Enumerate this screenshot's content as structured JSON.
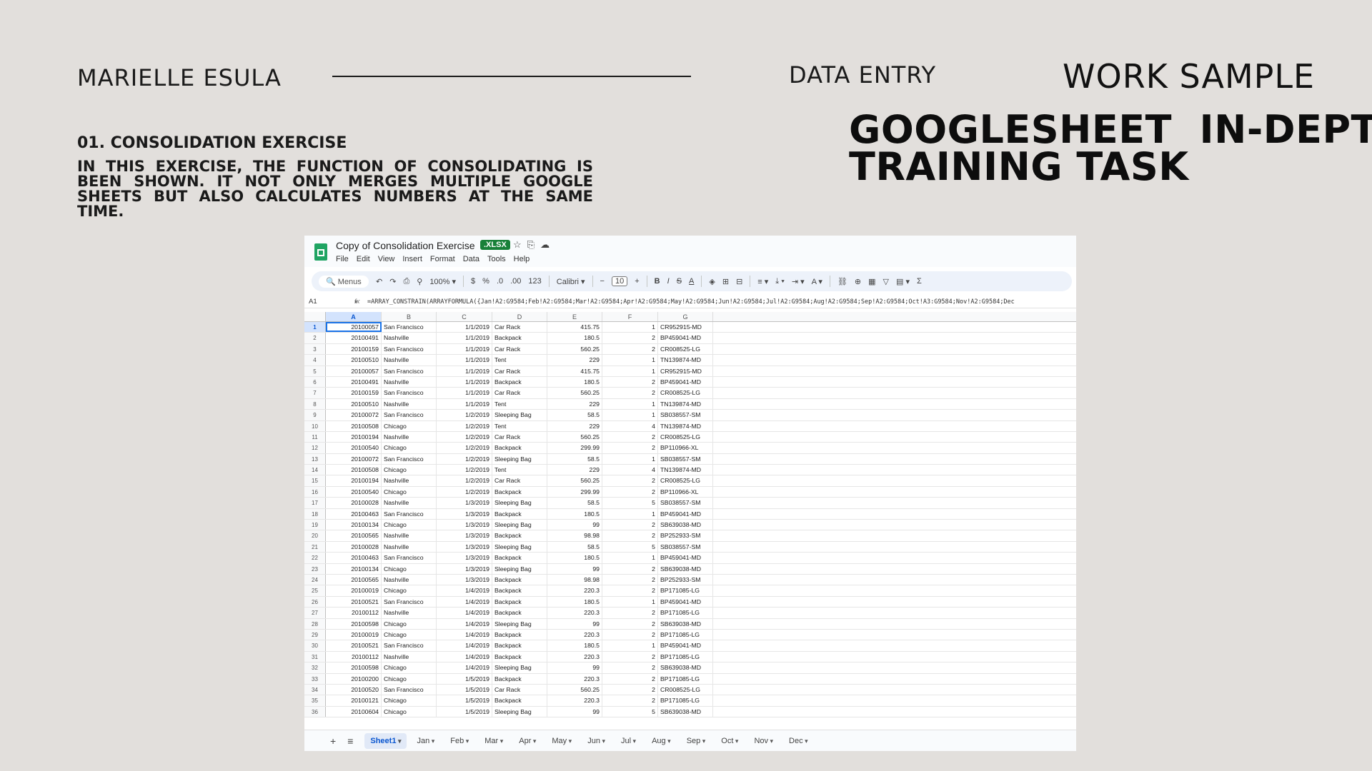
{
  "header": {
    "author": "MARIELLE ESULA",
    "category": "DATA ENTRY",
    "sample": "WORK SAMPLE",
    "headline_line1": "GOOGLESHEET  IN-DEPTH",
    "headline_line2": "TRAINING TASK"
  },
  "exercise": {
    "title": "01. CONSOLIDATION EXERCISE",
    "description": "IN THIS EXERCISE, THE FUNCTION OF CONSOLIDATING IS BEEN SHOWN. IT NOT ONLY MERGES MULTIPLE GOOGLE SHEETS BUT ALSO CALCULATES NUMBERS AT THE SAME TIME."
  },
  "sheet": {
    "doc_title": "Copy of Consolidation Exercise",
    "badge": ".XLSX",
    "title_icons": [
      "☆",
      "⎘",
      "☁"
    ],
    "menus": [
      "File",
      "Edit",
      "View",
      "Insert",
      "Format",
      "Data",
      "Tools",
      "Help"
    ],
    "toolbar": {
      "search": "Menus",
      "undo": "↶",
      "redo": "↷",
      "print": "⎙",
      "paint": "⚲",
      "zoom": "100% ▾",
      "currency": "$",
      "percent": "%",
      "dec_dec": ".0",
      "dec_inc": ".00",
      "numfmt": "123",
      "font": "Calibri ▾",
      "minus": "−",
      "size": "10",
      "plus": "+",
      "bold": "B",
      "italic": "I",
      "strike": "S",
      "textcolor": "A",
      "fill": "◈",
      "borders": "⊞",
      "merge": "⊟",
      "halign": "≡ ▾",
      "valign": "⤓ ▾",
      "wrap": "⇥ ▾",
      "rotate": "A ▾",
      "link": "⛓",
      "comment": "⊕",
      "chart": "▦",
      "filter": "▽",
      "views": "▤ ▾",
      "functions": "Σ"
    },
    "name_box": "A1",
    "name_box_arrow": "▾",
    "fx": "fx",
    "formula": "=ARRAY_CONSTRAIN(ARRAYFORMULA({Jan!A2:G9584;Feb!A2:G9584;Mar!A2:G9584;Apr!A2:G9584;May!A2:G9584;Jun!A2:G9584;Jul!A2:G9584;Aug!A2:G9584;Sep!A2:G9584;Oct!A3:G9584;Nov!A2:G9584;Dec",
    "columns": [
      "A",
      "B",
      "C",
      "D",
      "E",
      "F",
      "G"
    ],
    "rows": [
      [
        "1",
        "20100057",
        "San Francisco",
        "1/1/2019",
        "Car Rack",
        "415.75",
        "1",
        "CR952915-MD"
      ],
      [
        "2",
        "20100491",
        "Nashville",
        "1/1/2019",
        "Backpack",
        "180.5",
        "2",
        "BP459041-MD"
      ],
      [
        "3",
        "20100159",
        "San Francisco",
        "1/1/2019",
        "Car Rack",
        "560.25",
        "2",
        "CR008525-LG"
      ],
      [
        "4",
        "20100510",
        "Nashville",
        "1/1/2019",
        "Tent",
        "229",
        "1",
        "TN139874-MD"
      ],
      [
        "5",
        "20100057",
        "San Francisco",
        "1/1/2019",
        "Car Rack",
        "415.75",
        "1",
        "CR952915-MD"
      ],
      [
        "6",
        "20100491",
        "Nashville",
        "1/1/2019",
        "Backpack",
        "180.5",
        "2",
        "BP459041-MD"
      ],
      [
        "7",
        "20100159",
        "San Francisco",
        "1/1/2019",
        "Car Rack",
        "560.25",
        "2",
        "CR008525-LG"
      ],
      [
        "8",
        "20100510",
        "Nashville",
        "1/1/2019",
        "Tent",
        "229",
        "1",
        "TN139874-MD"
      ],
      [
        "9",
        "20100072",
        "San Francisco",
        "1/2/2019",
        "Sleeping Bag",
        "58.5",
        "1",
        "SB038557-SM"
      ],
      [
        "10",
        "20100508",
        "Chicago",
        "1/2/2019",
        "Tent",
        "229",
        "4",
        "TN139874-MD"
      ],
      [
        "11",
        "20100194",
        "Nashville",
        "1/2/2019",
        "Car Rack",
        "560.25",
        "2",
        "CR008525-LG"
      ],
      [
        "12",
        "20100540",
        "Chicago",
        "1/2/2019",
        "Backpack",
        "299.99",
        "2",
        "BP110966-XL"
      ],
      [
        "13",
        "20100072",
        "San Francisco",
        "1/2/2019",
        "Sleeping Bag",
        "58.5",
        "1",
        "SB038557-SM"
      ],
      [
        "14",
        "20100508",
        "Chicago",
        "1/2/2019",
        "Tent",
        "229",
        "4",
        "TN139874-MD"
      ],
      [
        "15",
        "20100194",
        "Nashville",
        "1/2/2019",
        "Car Rack",
        "560.25",
        "2",
        "CR008525-LG"
      ],
      [
        "16",
        "20100540",
        "Chicago",
        "1/2/2019",
        "Backpack",
        "299.99",
        "2",
        "BP110966-XL"
      ],
      [
        "17",
        "20100028",
        "Nashville",
        "1/3/2019",
        "Sleeping Bag",
        "58.5",
        "5",
        "SB038557-SM"
      ],
      [
        "18",
        "20100463",
        "San Francisco",
        "1/3/2019",
        "Backpack",
        "180.5",
        "1",
        "BP459041-MD"
      ],
      [
        "19",
        "20100134",
        "Chicago",
        "1/3/2019",
        "Sleeping Bag",
        "99",
        "2",
        "SB639038-MD"
      ],
      [
        "20",
        "20100565",
        "Nashville",
        "1/3/2019",
        "Backpack",
        "98.98",
        "2",
        "BP252933-SM"
      ],
      [
        "21",
        "20100028",
        "Nashville",
        "1/3/2019",
        "Sleeping Bag",
        "58.5",
        "5",
        "SB038557-SM"
      ],
      [
        "22",
        "20100463",
        "San Francisco",
        "1/3/2019",
        "Backpack",
        "180.5",
        "1",
        "BP459041-MD"
      ],
      [
        "23",
        "20100134",
        "Chicago",
        "1/3/2019",
        "Sleeping Bag",
        "99",
        "2",
        "SB639038-MD"
      ],
      [
        "24",
        "20100565",
        "Nashville",
        "1/3/2019",
        "Backpack",
        "98.98",
        "2",
        "BP252933-SM"
      ],
      [
        "25",
        "20100019",
        "Chicago",
        "1/4/2019",
        "Backpack",
        "220.3",
        "2",
        "BP171085-LG"
      ],
      [
        "26",
        "20100521",
        "San Francisco",
        "1/4/2019",
        "Backpack",
        "180.5",
        "1",
        "BP459041-MD"
      ],
      [
        "27",
        "20100112",
        "Nashville",
        "1/4/2019",
        "Backpack",
        "220.3",
        "2",
        "BP171085-LG"
      ],
      [
        "28",
        "20100598",
        "Chicago",
        "1/4/2019",
        "Sleeping Bag",
        "99",
        "2",
        "SB639038-MD"
      ],
      [
        "29",
        "20100019",
        "Chicago",
        "1/4/2019",
        "Backpack",
        "220.3",
        "2",
        "BP171085-LG"
      ],
      [
        "30",
        "20100521",
        "San Francisco",
        "1/4/2019",
        "Backpack",
        "180.5",
        "1",
        "BP459041-MD"
      ],
      [
        "31",
        "20100112",
        "Nashville",
        "1/4/2019",
        "Backpack",
        "220.3",
        "2",
        "BP171085-LG"
      ],
      [
        "32",
        "20100598",
        "Chicago",
        "1/4/2019",
        "Sleeping Bag",
        "99",
        "2",
        "SB639038-MD"
      ],
      [
        "33",
        "20100200",
        "Chicago",
        "1/5/2019",
        "Backpack",
        "220.3",
        "2",
        "BP171085-LG"
      ],
      [
        "34",
        "20100520",
        "San Francisco",
        "1/5/2019",
        "Car Rack",
        "560.25",
        "2",
        "CR008525-LG"
      ],
      [
        "35",
        "20100121",
        "Chicago",
        "1/5/2019",
        "Backpack",
        "220.3",
        "2",
        "BP171085-LG"
      ],
      [
        "36",
        "20100604",
        "Chicago",
        "1/5/2019",
        "Sleeping Bag",
        "99",
        "5",
        "SB639038-MD"
      ]
    ],
    "tab_add": "+",
    "tab_list": "≡",
    "tabs": [
      "Sheet1",
      "Jan",
      "Feb",
      "Mar",
      "Apr",
      "May",
      "Jun",
      "Jul",
      "Aug",
      "Sep",
      "Oct",
      "Nov",
      "Dec"
    ]
  }
}
